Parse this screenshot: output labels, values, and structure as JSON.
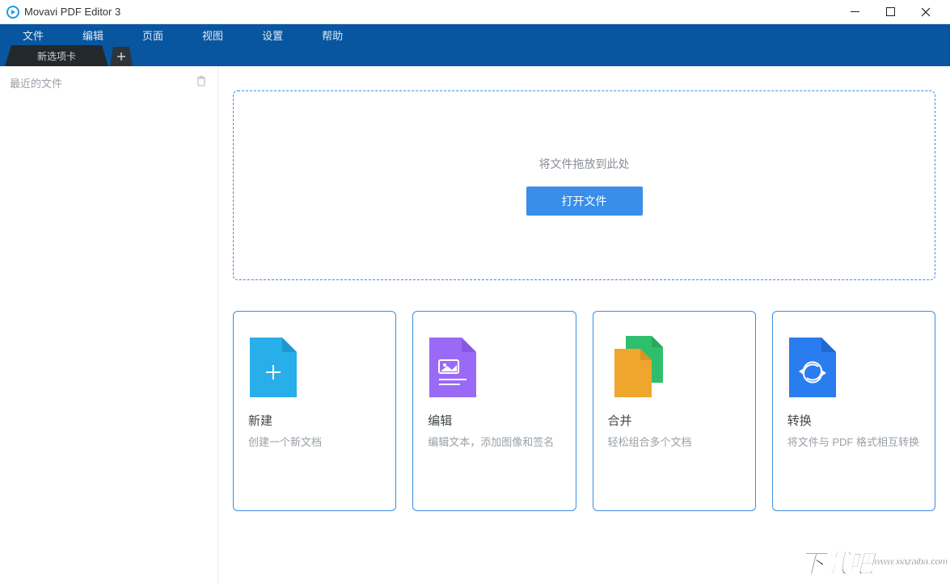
{
  "titlebar": {
    "title": "Movavi PDF Editor 3"
  },
  "menu": {
    "file": "文件",
    "edit": "编辑",
    "page": "页面",
    "view": "视图",
    "settings": "设置",
    "help": "帮助"
  },
  "tab": {
    "label": "新选项卡"
  },
  "sidebar": {
    "recent_title": "最近的文件"
  },
  "dropzone": {
    "hint": "将文件拖放到此处",
    "open_button": "打开文件"
  },
  "cards": {
    "new": {
      "title": "新建",
      "desc": "创建一个新文档"
    },
    "edit": {
      "title": "编辑",
      "desc": "编辑文本，添加图像和签名"
    },
    "merge": {
      "title": "合并",
      "desc": "轻松组合多个文档"
    },
    "convert": {
      "title": "转换",
      "desc": "将文件与 PDF 格式相互转换"
    }
  },
  "watermark": {
    "big": "下载吧",
    "small": "www.xiazaiba.com"
  }
}
